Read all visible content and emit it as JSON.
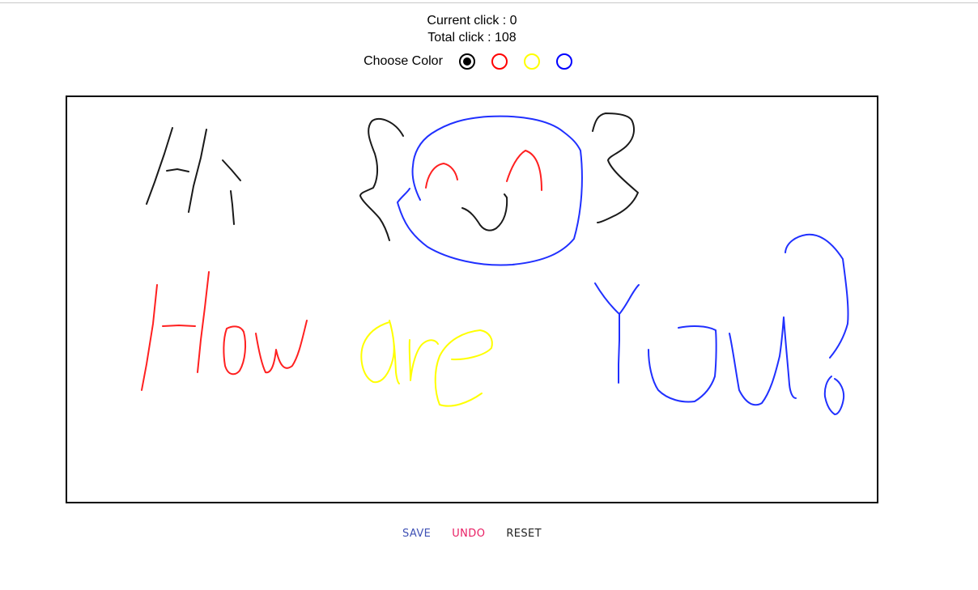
{
  "stats": {
    "current_label": "Current click : 0",
    "total_label": "Total click : 108"
  },
  "color_picker": {
    "label": "Choose Color",
    "options": [
      {
        "name": "black",
        "color": "#000000",
        "selected": true
      },
      {
        "name": "red",
        "color": "#ff0000",
        "selected": false
      },
      {
        "name": "yellow",
        "color": "#ffff00",
        "selected": false
      },
      {
        "name": "blue",
        "color": "#0000ff",
        "selected": false
      }
    ]
  },
  "canvas": {
    "drawing_colors": {
      "black": "#1a1a1a",
      "red": "#ff2020",
      "yellow": "#ffff00",
      "blue": "#2030ff"
    }
  },
  "buttons": {
    "save": {
      "label": "SAVE",
      "color": "#3f51b5"
    },
    "undo": {
      "label": "UNDO",
      "color": "#e91e63"
    },
    "reset": {
      "label": "RESET",
      "color": "#222222"
    }
  }
}
